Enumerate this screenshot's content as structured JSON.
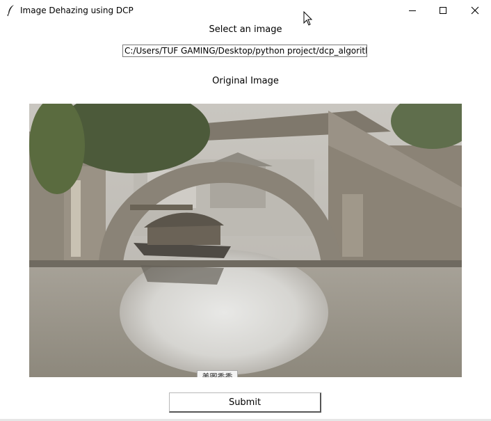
{
  "window": {
    "title": "Image Dehazing using DCP",
    "app_icon": "feather-icon",
    "controls": [
      "minimize-icon",
      "maximize-icon",
      "close-icon"
    ]
  },
  "form": {
    "select_label": "Select an image",
    "path_value": "C:/Users/TUF GAMING/Desktop/python project/dcp_algorith",
    "original_label": "Original Image",
    "submit_label": "Submit"
  },
  "image": {
    "watermark": "美图秀秀"
  }
}
